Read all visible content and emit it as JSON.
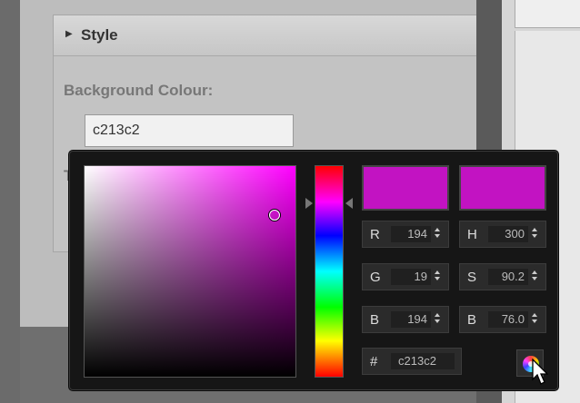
{
  "style_section": {
    "header_title": "Style",
    "background_label": "Background Colour:",
    "background_value": "c213c2",
    "text_label": "Te"
  },
  "picker": {
    "new_color": "#c213c2",
    "current_color": "#c213c2",
    "hue_gradient_top_color": "#ff00ff",
    "rgb": [
      {
        "label": "R",
        "value": "194"
      },
      {
        "label": "G",
        "value": "19"
      },
      {
        "label": "B",
        "value": "194"
      }
    ],
    "hsb": [
      {
        "label": "H",
        "value": "300"
      },
      {
        "label": "S",
        "value": "90.2"
      },
      {
        "label": "B",
        "value": "76.0"
      }
    ],
    "hex": {
      "label": "#",
      "value": "c213c2"
    },
    "wheel_icon": "color-wheel-icon"
  }
}
